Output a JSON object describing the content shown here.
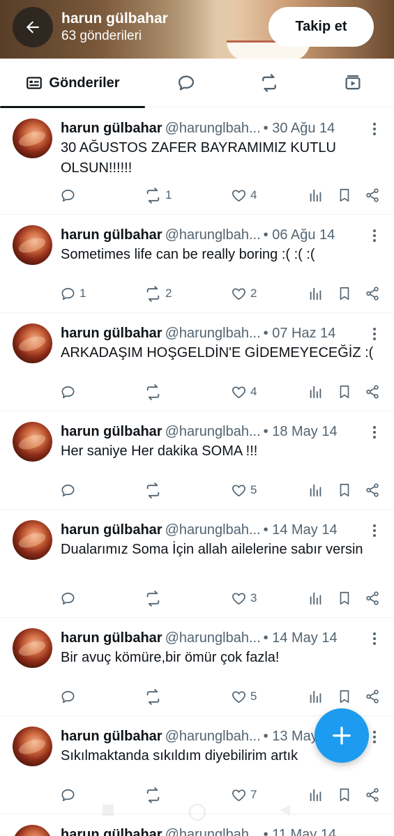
{
  "header": {
    "profile_name": "harun gülbahar",
    "post_count_label": "63 gönderileri",
    "follow_label": "Takip et"
  },
  "tabs": [
    {
      "label": "Gönderiler",
      "icon": "posts-icon",
      "active": true
    },
    {
      "label": "",
      "icon": "replies-icon",
      "active": false
    },
    {
      "label": "",
      "icon": "repost-icon",
      "active": false
    },
    {
      "label": "",
      "icon": "media-icon",
      "active": false
    }
  ],
  "tweets": [
    {
      "name": "harun gülbahar",
      "handle": "@harunglbah...",
      "date": "• 30 Ağu 14",
      "text": "30 AĞUSTOS ZAFER BAYRAMIMIZ KUTLU OLSUN!!!!!!",
      "replies": "",
      "reposts": "1",
      "likes": "4"
    },
    {
      "name": "harun gülbahar",
      "handle": "@harunglbah...",
      "date": "• 06 Ağu 14",
      "text": "Sometimes life can be really boring :( :( :(",
      "replies": "1",
      "reposts": "2",
      "likes": "2"
    },
    {
      "name": "harun gülbahar",
      "handle": "@harunglbah...",
      "date": "• 07 Haz 14",
      "text": "ARKADAŞIM HOŞGELDİN'E GİDEMEYECEĞİZ :(",
      "replies": "",
      "reposts": "",
      "likes": "4"
    },
    {
      "name": "harun gülbahar",
      "handle": "@harunglbah...",
      "date": "• 18 May 14",
      "text": "Her saniye Her dakika SOMA !!!",
      "replies": "",
      "reposts": "",
      "likes": "5"
    },
    {
      "name": "harun gülbahar",
      "handle": "@harunglbah...",
      "date": "• 14 May 14",
      "text": "Dualarımız Soma İçin allah ailelerine sabır versin",
      "replies": "",
      "reposts": "",
      "likes": "3"
    },
    {
      "name": "harun gülbahar",
      "handle": "@harunglbah...",
      "date": "• 14 May 14",
      "text": "Bir avuç kömüre,bir ömür çok fazla!",
      "replies": "",
      "reposts": "",
      "likes": "5"
    },
    {
      "name": "harun gülbahar",
      "handle": "@harunglbah...",
      "date": "• 13 May 14",
      "text": "Sıkılmaktanda sıkıldım diyebilirim artık",
      "replies": "",
      "reposts": "",
      "likes": "7"
    },
    {
      "name": "harun gülbahar",
      "handle": "@harunglbah...",
      "date": "• 11 May 14",
      "text": "",
      "replies": "",
      "reposts": "",
      "likes": ""
    }
  ],
  "colors": {
    "accent": "#1d9bf0",
    "text": "#0f1419",
    "muted": "#536471",
    "divider": "#eff3f4"
  }
}
